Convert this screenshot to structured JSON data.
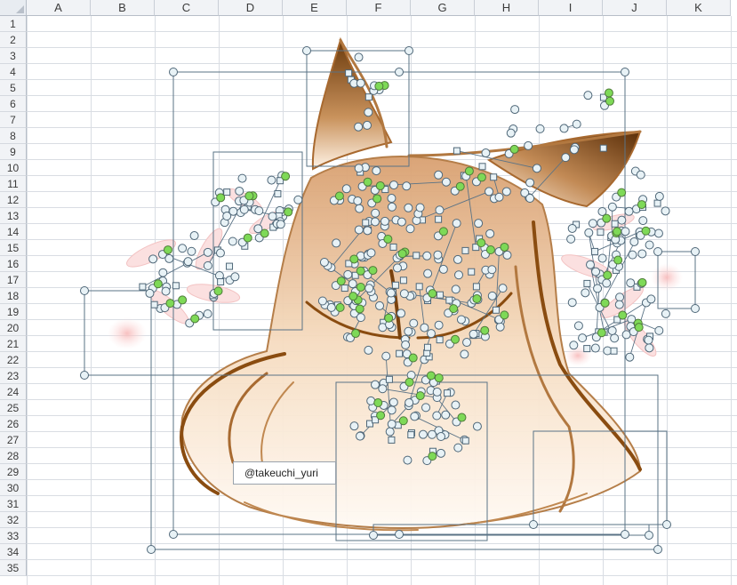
{
  "app": "Spreadsheet",
  "columns": [
    "A",
    "B",
    "C",
    "D",
    "E",
    "F",
    "G",
    "H",
    "I",
    "J",
    "K"
  ],
  "rows": [
    "1",
    "2",
    "3",
    "4",
    "5",
    "6",
    "7",
    "8",
    "9",
    "10",
    "11",
    "12",
    "13",
    "14",
    "15",
    "16",
    "17",
    "18",
    "19",
    "20",
    "21",
    "22",
    "23",
    "24",
    "25",
    "26",
    "27",
    "28",
    "29",
    "30",
    "31",
    "32",
    "33",
    "34",
    "35"
  ],
  "drawing": {
    "subject": "Cat-eared character line art built from shapes, with selection handles and control points visible",
    "credit_text": "@takeuchi_yuri"
  },
  "colors": {
    "grid_line": "#d9dde3",
    "header_bg": "#f1f3f6",
    "selection_line": "#5a7386",
    "handle_fill": "#e8f2f6",
    "adjust_handle": "#7ed957",
    "hair_brown": "#8a4c10",
    "hair_tan": "#e7b98a",
    "blush_pink": "#f8c9c9"
  }
}
